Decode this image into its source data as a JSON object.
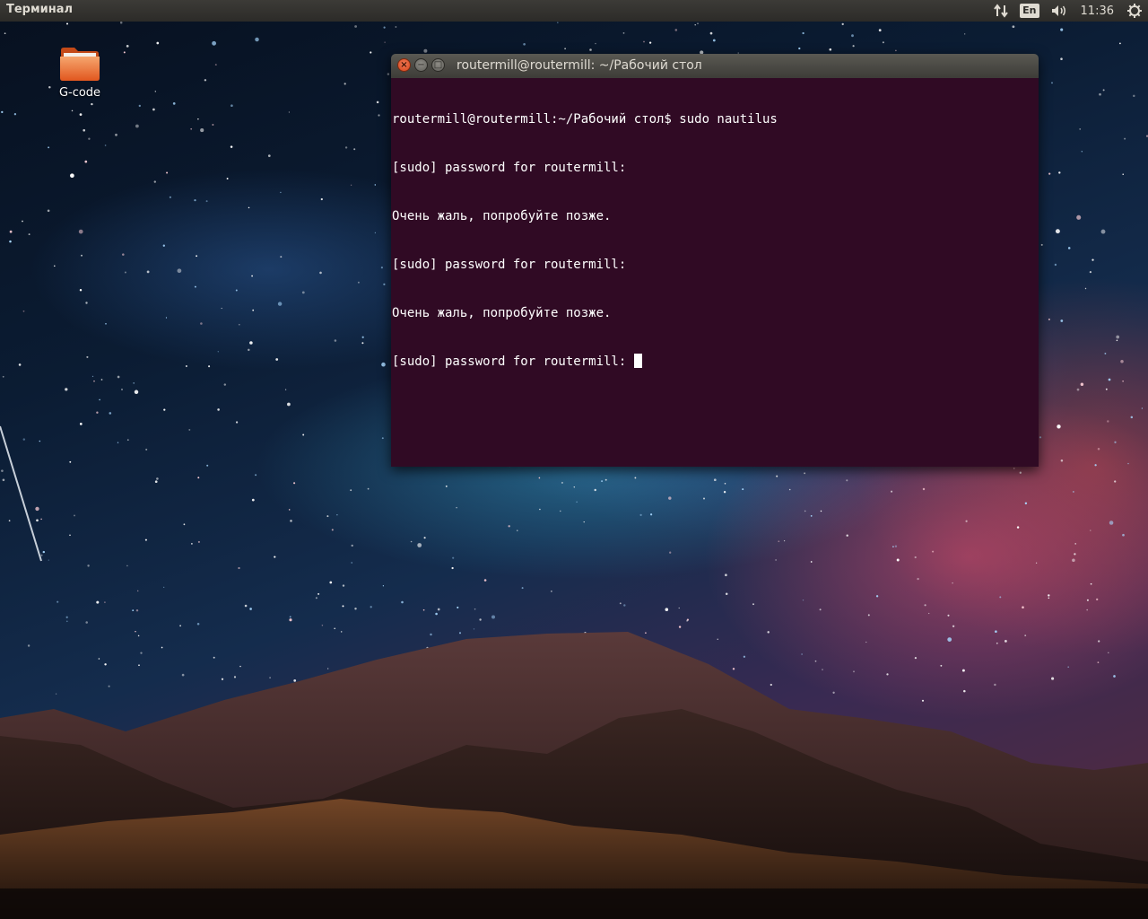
{
  "panel": {
    "app_title": "Терминал",
    "lang": "En",
    "clock": "11:36",
    "icons": [
      "network-arrows-icon",
      "volume-icon",
      "power-gear-icon"
    ]
  },
  "desktop": {
    "icons": [
      {
        "label": "G-code",
        "icon": "folder-icon",
        "color": "#f07b3f"
      }
    ]
  },
  "terminal": {
    "title": "routermill@routermill: ~/Рабочий стол",
    "buttons": {
      "close": "×",
      "minimize": "−",
      "maximize": "□"
    },
    "lines": [
      "routermill@routermill:~/Рабочий стол$ sudo nautilus",
      "[sudo] password for routermill:",
      "Очень жаль, попробуйте позже.",
      "[sudo] password for routermill:",
      "Очень жаль, попробуйте позже.",
      "[sudo] password for routermill: "
    ],
    "background": "#300a24",
    "foreground": "#ffffff"
  },
  "colors": {
    "panel": "#3c3b37",
    "close_button": "#e95420"
  }
}
